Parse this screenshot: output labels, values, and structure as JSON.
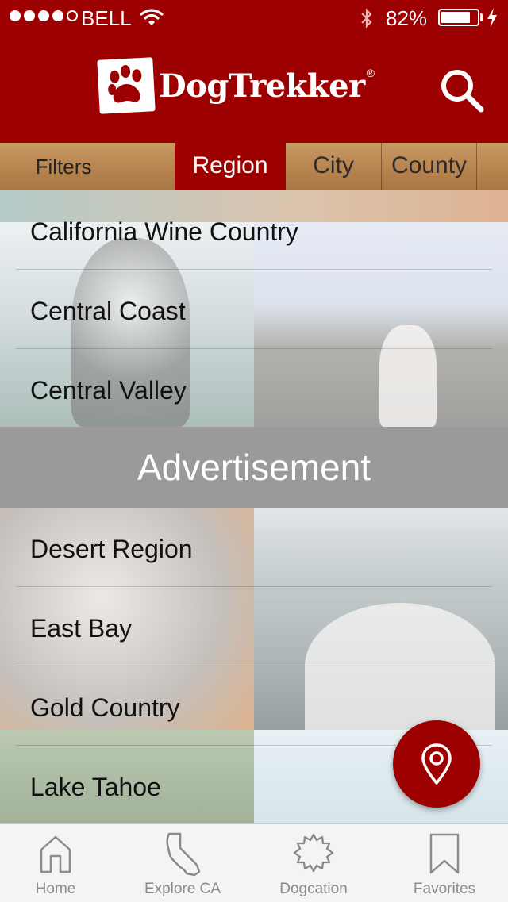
{
  "status_bar": {
    "carrier": "BELL",
    "signal_bars": 4,
    "battery_percent": "82%",
    "battery_level": 0.82
  },
  "header": {
    "app_name": "DogTrekker",
    "trademark": "®",
    "icons": {
      "logo": "paw-logo-icon",
      "search": "search-icon"
    }
  },
  "filters": {
    "label": "Filters",
    "tabs": [
      {
        "label": "Region",
        "active": true
      },
      {
        "label": "City",
        "active": false
      },
      {
        "label": "County",
        "active": false
      }
    ]
  },
  "regions": [
    "California Wine Country",
    "Central Coast",
    "Central Valley",
    "Desert Region",
    "East Bay",
    "Gold Country",
    "Lake Tahoe"
  ],
  "advertisement": {
    "label": "Advertisement"
  },
  "map_button": {
    "icon": "map-pin-icon"
  },
  "tab_bar": [
    {
      "label": "Home",
      "icon": "home-icon"
    },
    {
      "label": "Explore CA",
      "icon": "california-map-icon"
    },
    {
      "label": "Dogcation",
      "icon": "badge-icon"
    },
    {
      "label": "Favorites",
      "icon": "bookmark-icon"
    }
  ],
  "colors": {
    "brand": "#9c0000",
    "filter_bar": "#b98550",
    "ad_banner": "#9a9a9a",
    "tab_bar": "#f4f4f4"
  }
}
